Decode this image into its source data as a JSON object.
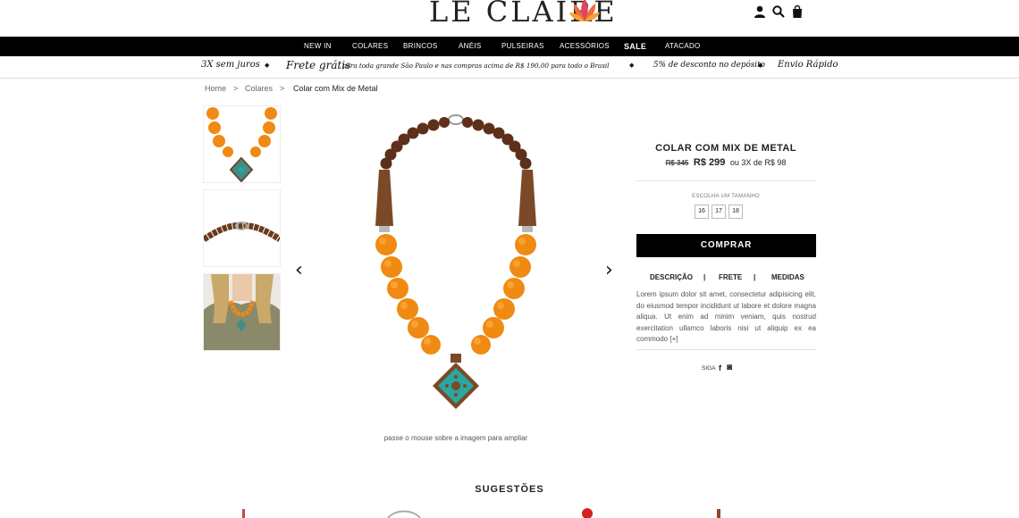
{
  "header": {
    "logo": "LE CLAIRE",
    "icons": [
      "user-icon",
      "search-icon",
      "bag-icon"
    ]
  },
  "nav": {
    "items": [
      "NEW IN",
      "COLARES",
      "BRINCOS",
      "ANÉIS",
      "PULSEIRAS",
      "ACESSÓRIOS",
      "SALE",
      "ATACADO"
    ]
  },
  "promo": {
    "installments": "3X sem juros",
    "shipping_big": "Frete grátis",
    "shipping_rest": "para toda grande São Paulo e nas compras acima de R$ 190,00 para todo o Brasil",
    "discount": "5% de desconto no depósito",
    "fast": "Envio Rápido"
  },
  "breadcrumb": {
    "home": "Home",
    "category": "Colares",
    "current": "Colar com Mix de Metal",
    "separator": ">"
  },
  "gallery": {
    "prev": "‹",
    "next": "›",
    "zoom_hint": "passe o mouse sobre a imagem para ampliar"
  },
  "product": {
    "title": "COLAR COM MIX DE METAL",
    "old_price": "R$ 345",
    "price": "R$ 299",
    "installments": "ou 3X de R$ 98",
    "size_label": "ESCOLHA UM TAMANHO",
    "sizes": [
      "16",
      "17",
      "18"
    ],
    "buy_label": "COMPRAR",
    "tabs": [
      "DESCRIÇÃO",
      "FRETE",
      "MEDIDAS"
    ],
    "tab_separator": "|",
    "description": "Lorem ipsum dolor sit amet, consectetur adipisicing elit, do eiusmod tempor incididunt ut labore et dolore magna aliqua. Ut enim ad minim veniam, quis nostrud exercitation ullamco laboris nisi ut aliquip ex ea commodo [+]",
    "follow_label": "SIGA",
    "social_icons": [
      "facebook-icon",
      "instagram-icon"
    ],
    "facebook_glyph": "f",
    "instagram_glyph": "◙"
  },
  "suggestions": {
    "title": "SUGESTÕES"
  },
  "colors": {
    "amber": "#f08a12",
    "amber_light": "#ffb347",
    "turquoise": "#2aa7a0",
    "bronze": "#7a4a26",
    "nav_bg": "#000000"
  }
}
